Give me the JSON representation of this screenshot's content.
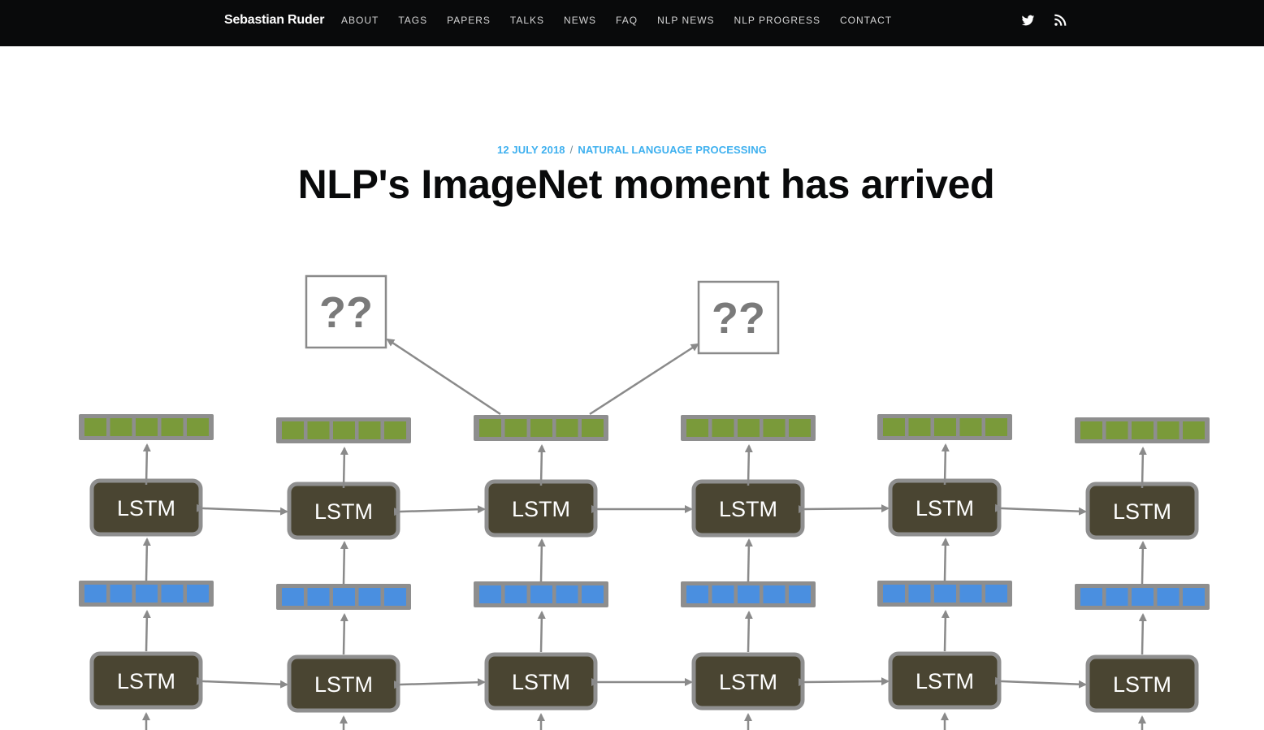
{
  "site": {
    "brand": "Sebastian Ruder",
    "nav": [
      "About",
      "Tags",
      "Papers",
      "Talks",
      "News",
      "FAQ",
      "NLP News",
      "NLP Progress",
      "Contact"
    ],
    "social": [
      {
        "icon": "twitter-icon"
      },
      {
        "icon": "rss-icon"
      }
    ]
  },
  "post": {
    "date": "12 July 2018",
    "tag": "Natural Language Processing",
    "title": "NLP's ImageNet moment has arrived"
  },
  "feature_image": {
    "output_label": "??",
    "cell_label": "LSTM",
    "colors": {
      "lstm_fill": "#4a4532",
      "lstm_border": "#8f8f8f",
      "green_cell": "#7a9a3a",
      "blue_cell": "#4a8fe0",
      "arrow": "#8a8a8a"
    }
  },
  "colors": {
    "topbar": "#090a0b",
    "accent": "#3eb0ef",
    "title": "#090a0b"
  }
}
